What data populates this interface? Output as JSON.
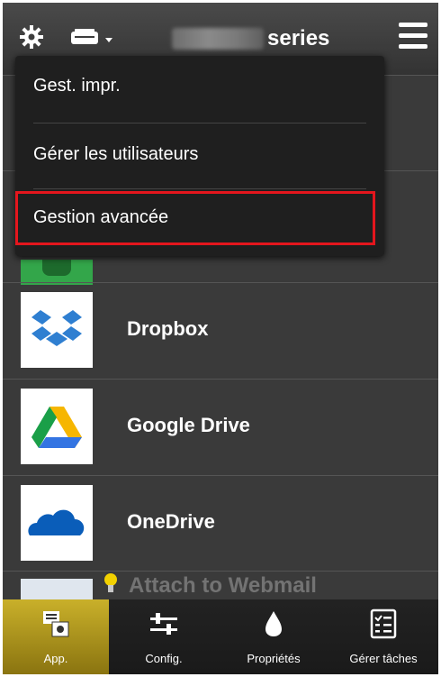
{
  "header": {
    "printer_name_suffix": "series",
    "model_name_visible": false
  },
  "dropdown": {
    "items": [
      {
        "label": "Gest. impr."
      },
      {
        "label": "Gérer les utilisateurs"
      },
      {
        "label": "Gestion avancée",
        "highlighted": true
      }
    ],
    "highlight_color": "#e4161d"
  },
  "apps": [
    {
      "label": "Dropbox",
      "icon": "dropbox-icon"
    },
    {
      "label": "Google Drive",
      "icon": "google-drive-icon"
    },
    {
      "label": "OneDrive",
      "icon": "onedrive-icon"
    },
    {
      "label": "Attach to Webmail",
      "icon": "webmail-icon"
    }
  ],
  "bottom_bar": {
    "tabs": [
      {
        "label": "App.",
        "icon": "app-icon",
        "active": true
      },
      {
        "label": "Config.",
        "icon": "sliders-icon"
      },
      {
        "label": "Propriétés",
        "icon": "ink-drop-icon"
      },
      {
        "label": "Gérer tâches",
        "icon": "checklist-icon"
      }
    ]
  },
  "colors": {
    "background": "#3a3a3a",
    "active_tab": "#c9b02a",
    "dropbox_blue": "#2f7fd1",
    "onedrive_blue": "#0a5db9"
  }
}
